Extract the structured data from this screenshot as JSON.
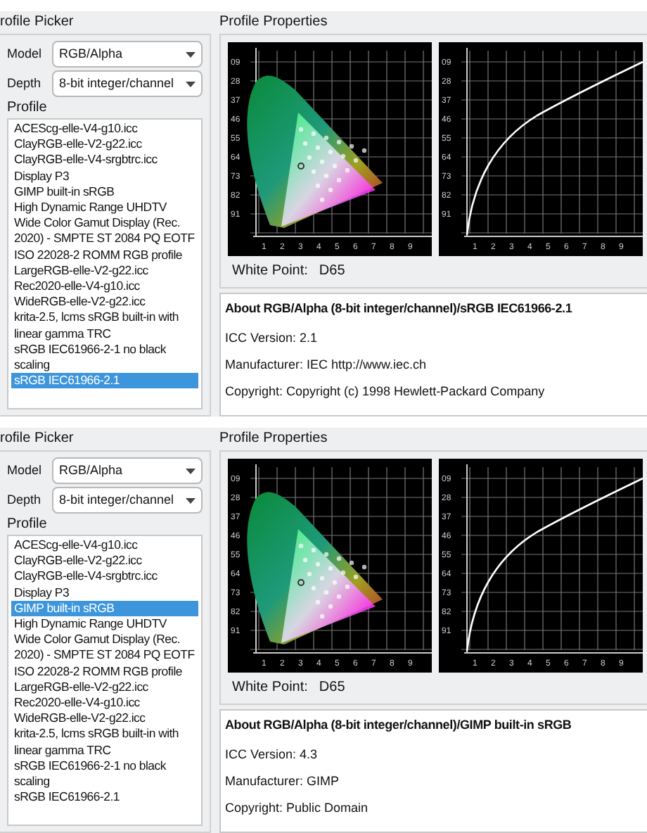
{
  "panels": [
    {
      "picker": {
        "title": "rofile Picker",
        "model": {
          "label": "Model",
          "value": "RGB/Alpha"
        },
        "depth": {
          "label": "Depth",
          "value": "8-bit integer/channel"
        },
        "profile_label": "Profile",
        "profiles": [
          {
            "label": "ACEScg-elle-V4-g10.icc",
            "selected": false
          },
          {
            "label": "ClayRGB-elle-V2-g22.icc",
            "selected": false
          },
          {
            "label": "ClayRGB-elle-V4-srgbtrc.icc",
            "selected": false
          },
          {
            "label": "Display P3",
            "selected": false
          },
          {
            "label": "GIMP built-in sRGB",
            "selected": false
          },
          {
            "label": "High Dynamic Range UHDTV Wide Color Gamut Display (Rec. 2020) - SMPTE ST 2084 PQ EOTF",
            "selected": false
          },
          {
            "label": "ISO 22028-2 ROMM RGB profile",
            "selected": false
          },
          {
            "label": "LargeRGB-elle-V2-g22.icc",
            "selected": false
          },
          {
            "label": "Rec2020-elle-V4-g10.icc",
            "selected": false
          },
          {
            "label": "WideRGB-elle-V2-g22.icc",
            "selected": false
          },
          {
            "label": "krita-2.5, lcms sRGB built-in with linear gamma TRC",
            "selected": false
          },
          {
            "label": "sRGB IEC61966-2-1 no black scaling",
            "selected": false
          },
          {
            "label": "sRGB IEC61966-2.1",
            "selected": true
          }
        ]
      },
      "properties": {
        "title": "Profile Properties",
        "gamut_plot": {
          "y_ticks": [
            "09",
            "28",
            "37",
            "46",
            "55",
            "64",
            "73",
            "82",
            "91"
          ],
          "x_ticks": [
            "1",
            "2",
            "3",
            "4",
            "5",
            "6",
            "7",
            "8",
            "9"
          ]
        },
        "curve_plot": {
          "y_ticks": [
            "09",
            "28",
            "37",
            "46",
            "55",
            "64",
            "73",
            "82",
            "91"
          ],
          "x_ticks": [
            "1",
            "2",
            "3",
            "4",
            "5",
            "6",
            "7",
            "8",
            "9"
          ]
        },
        "white_point": {
          "label": "White Point:",
          "value": "D65"
        },
        "about": {
          "title": "About RGB/Alpha (8-bit integer/channel)/sRGB IEC61966-2.1",
          "lines": [
            "ICC Version: 2.1",
            "Manufacturer: IEC http://www.iec.ch",
            "Copyright: Copyright (c) 1998 Hewlett-Packard Company"
          ]
        }
      }
    },
    {
      "picker": {
        "title": "rofile Picker",
        "model": {
          "label": "Model",
          "value": "RGB/Alpha"
        },
        "depth": {
          "label": "Depth",
          "value": "8-bit integer/channel"
        },
        "profile_label": "Profile",
        "profiles": [
          {
            "label": "ACEScg-elle-V4-g10.icc",
            "selected": false
          },
          {
            "label": "ClayRGB-elle-V2-g22.icc",
            "selected": false
          },
          {
            "label": "ClayRGB-elle-V4-srgbtrc.icc",
            "selected": false
          },
          {
            "label": "Display P3",
            "selected": false
          },
          {
            "label": "GIMP built-in sRGB",
            "selected": true
          },
          {
            "label": "High Dynamic Range UHDTV Wide Color Gamut Display (Rec. 2020) - SMPTE ST 2084 PQ EOTF",
            "selected": false
          },
          {
            "label": "ISO 22028-2 ROMM RGB profile",
            "selected": false
          },
          {
            "label": "LargeRGB-elle-V2-g22.icc",
            "selected": false
          },
          {
            "label": "Rec2020-elle-V4-g10.icc",
            "selected": false
          },
          {
            "label": "WideRGB-elle-V2-g22.icc",
            "selected": false
          },
          {
            "label": "krita-2.5, lcms sRGB built-in with linear gamma TRC",
            "selected": false
          },
          {
            "label": "sRGB IEC61966-2-1 no black scaling",
            "selected": false
          },
          {
            "label": "sRGB IEC61966-2.1",
            "selected": false
          }
        ]
      },
      "properties": {
        "title": "Profile Properties",
        "gamut_plot": {
          "y_ticks": [
            "09",
            "28",
            "37",
            "46",
            "55",
            "64",
            "73",
            "82",
            "91"
          ],
          "x_ticks": [
            "1",
            "2",
            "3",
            "4",
            "5",
            "6",
            "7",
            "8",
            "9"
          ]
        },
        "curve_plot": {
          "y_ticks": [
            "09",
            "28",
            "37",
            "46",
            "55",
            "64",
            "73",
            "82",
            "91"
          ],
          "x_ticks": [
            "1",
            "2",
            "3",
            "4",
            "5",
            "6",
            "7",
            "8",
            "9"
          ]
        },
        "white_point": {
          "label": "White Point:",
          "value": "D65"
        },
        "about": {
          "title": "About RGB/Alpha (8-bit integer/channel)/GIMP built-in sRGB",
          "lines": [
            "ICC Version: 4.3",
            "Manufacturer: GIMP",
            "Copyright: Public Domain"
          ]
        }
      }
    }
  ]
}
